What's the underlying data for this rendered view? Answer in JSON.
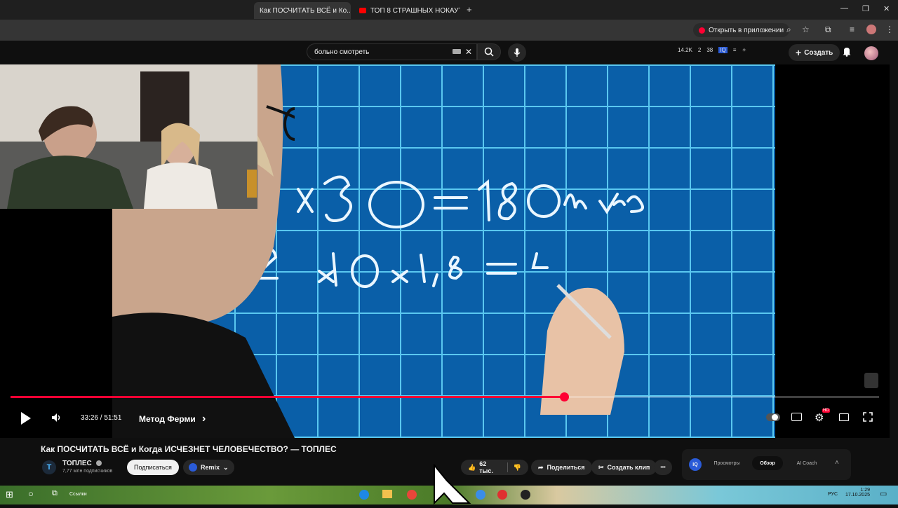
{
  "browser": {
    "tabs": [
      {
        "label": "Как ПОСЧИТАТЬ ВСЁ и Ко...",
        "active": true
      },
      {
        "label": "ТОП 8 СТРАШНЫХ НОКАУТОВ",
        "active": false
      }
    ],
    "new_tab": "+",
    "window_controls": {
      "minimize": "—",
      "restore": "❐",
      "close": "✕"
    },
    "open_in_app": "Открыть в приложении"
  },
  "youtube_header": {
    "search_value": "больно смотреть",
    "clear": "✕",
    "search_icon": "search-icon",
    "mic_icon": "mic-icon",
    "ext_stats": [
      "14.2K",
      "2",
      "38"
    ],
    "create_label": "Создать",
    "create_plus": "+"
  },
  "player": {
    "current_time": "33:26",
    "separator": " / ",
    "duration": "51:51",
    "progress": 0.637,
    "chapter": "Метод Ферми",
    "chapter_arrow": "›",
    "hd_badge": "HD"
  },
  "video": {
    "title": "Как ПОСЧИТАТЬ ВСЁ и Когда ИСЧЕЗНЕТ ЧЕЛОВЕЧЕСТВО? — ТОПЛЕС",
    "channel_name": "ТОПЛЕС",
    "channel_initial": "T",
    "subscribers": "7,77 млн подписчиков",
    "subscribe_label": "Подписаться",
    "remix_label": "Remix",
    "likes": "62 тыс.",
    "share_label": "Поделиться",
    "clip_label": "Создать клип",
    "more": "•••"
  },
  "ext_panel": {
    "logo": "IQ",
    "tabs": [
      "Просмотры",
      "Обзор",
      "AI Coach"
    ],
    "active_tab": "Обзор",
    "collapse": "˄"
  },
  "taskbar": {
    "links_label": "Ссылки",
    "lang": "РУС",
    "time": "1:29",
    "date": "17.10.2025"
  },
  "whiteboard": {
    "line1": "×30 = 180 лн кр",
    "line2": "25 × 10 × 1,8 = 4"
  }
}
